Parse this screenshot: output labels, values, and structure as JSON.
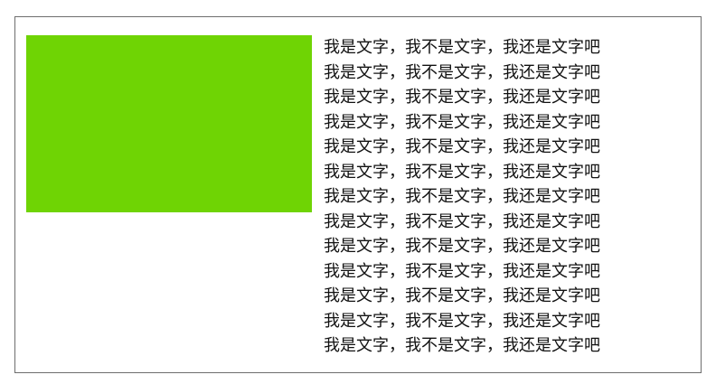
{
  "demo": {
    "box_color": "#6fd404",
    "lines": [
      "我是文字，我不是文字，我还是文字吧",
      "我是文字，我不是文字，我还是文字吧",
      "我是文字，我不是文字，我还是文字吧",
      "我是文字，我不是文字，我还是文字吧",
      "我是文字，我不是文字，我还是文字吧",
      "我是文字，我不是文字，我还是文字吧",
      "我是文字，我不是文字，我还是文字吧",
      "我是文字，我不是文字，我还是文字吧",
      "我是文字，我不是文字，我还是文字吧",
      "我是文字，我不是文字，我还是文字吧",
      "我是文字，我不是文字，我还是文字吧",
      "我是文字，我不是文字，我还是文字吧",
      "我是文字，我不是文字，我还是文字吧"
    ]
  }
}
